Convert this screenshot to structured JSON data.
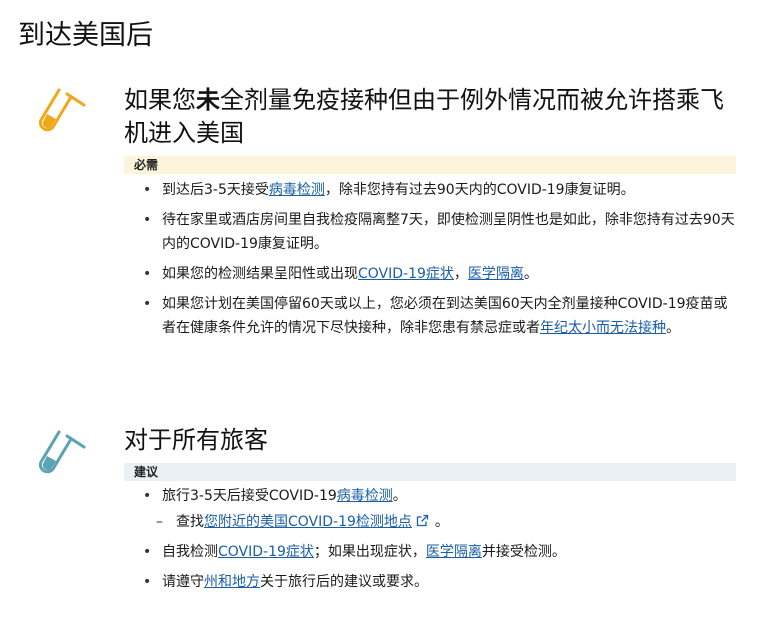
{
  "page": {
    "title": "到达美国后"
  },
  "section1": {
    "icon": "test-tube-icon",
    "icon_color": "#f0a81b",
    "title_pre": "如果您",
    "title_bold": "未",
    "title_post": "全剂量免疫接种但由于例外情况而被允许搭乘飞机进入美国",
    "tag": "必需",
    "items": [
      {
        "t1": "到达后3-5天接受",
        "link1": "病毒检测",
        "t2": "，除非您持有过去90天内的COVID-19康复证明。"
      },
      {
        "t1": "待在家里或酒店房间里自我检疫隔离整7天，即使检测呈阴性也是如此，除非您持有过去90天内的COVID-19康复证明。"
      },
      {
        "t1": "如果您的检测结果呈阳性或出现",
        "link1": "COVID-19症状",
        "t2": "，",
        "link2": "医学隔离",
        "t3": "。"
      },
      {
        "t1": "如果您计划在美国停留60天或以上，您必须在到达美国60天内全剂量接种COVID-19疫苗或者在健康条件允许的情况下尽快接种，除非您患有禁忌症或者",
        "link1": "年纪太小而无法接种",
        "t2": "。"
      }
    ]
  },
  "section2": {
    "icon": "test-tube-icon",
    "icon_color": "#5aa3b3",
    "title": "对于所有旅客",
    "tag": "建议",
    "items": [
      {
        "t1": "旅行3-5天后接受COVID-19",
        "link1": "病毒检测",
        "t2": "。"
      },
      {
        "t1": "查找",
        "link1": "您附近的美国COVID-19检测地点",
        "t2": "。"
      },
      {
        "t1": "自我检测",
        "link1": "COVID-19症状",
        "t2": "；如果出现症状，",
        "link2": "医学隔离",
        "t3": "并接受检测。"
      },
      {
        "t1": "请遵守",
        "link1": "州和地方",
        "t2": "关于旅行后的建议或要求。"
      }
    ]
  }
}
